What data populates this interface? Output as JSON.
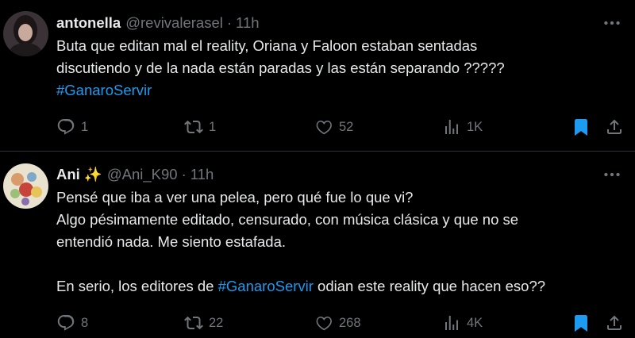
{
  "tweets": [
    {
      "name": "antonella",
      "handle": "@revivalerasel",
      "separator": "·",
      "time": "11h",
      "lines": [
        "Buta que editan mal el reality, Oriana y Faloon estaban sentadas",
        "discutiendo y de la nada están paradas y las están separando ?????"
      ],
      "hashtag": "#GanaroServir",
      "replies": "1",
      "retweets": "1",
      "likes": "52",
      "views": "1K",
      "bookmarked": true
    },
    {
      "name": "Ani",
      "emoji": "✨",
      "handle": "@Ani_K90",
      "separator": "·",
      "time": "11h",
      "lines": [
        "Pensé que iba a ver una pelea, pero qué fue lo que vi?",
        "Algo pésimamente editado, censurado, con música clásica y que no se",
        "entendió nada. Me siento estafada."
      ],
      "last_line_prefix": "En serio, los editores de ",
      "hashtag": "#GanaroServir",
      "last_line_suffix": " odian este reality que hacen eso??",
      "replies": "8",
      "retweets": "22",
      "likes": "268",
      "views": "4K",
      "bookmarked": true
    }
  ],
  "colors": {
    "background": "#000000",
    "text": "#e7e9ea",
    "muted": "#71767b",
    "link": "#1d9bf0",
    "divider": "#2f3336"
  }
}
